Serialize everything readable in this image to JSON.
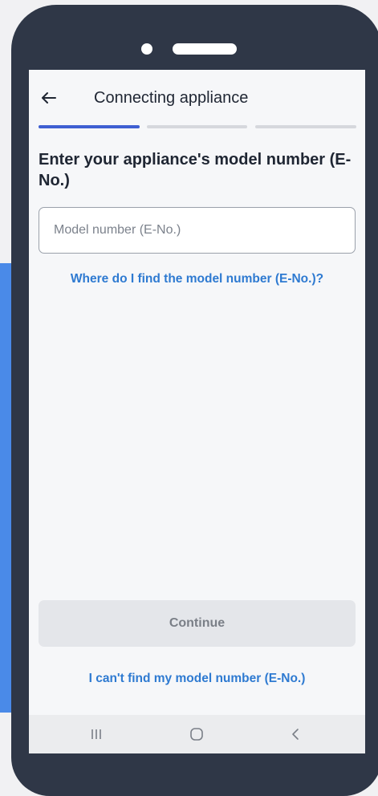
{
  "header": {
    "title": "Connecting appliance",
    "back_icon": "arrow-left-icon"
  },
  "progress": {
    "steps_total": 3,
    "current_step": 1,
    "current_step_fill": 1.0,
    "accent_color": "#3f5fd2"
  },
  "content": {
    "heading": "Enter your appliance's model number (E-No.)",
    "model_input": {
      "placeholder": "Model number (E-No.)",
      "value": ""
    },
    "help_link": "Where do I find the model number (E-No.)?"
  },
  "footer": {
    "continue_label": "Continue",
    "cant_find_link": "I can't find my model number (E-No.)"
  },
  "system_nav": {
    "recents_icon": "recents-icon",
    "home_icon": "home-icon",
    "back_icon": "back-chevron-icon"
  },
  "colors": {
    "link": "#2e7ad1",
    "device_frame": "#2f3747",
    "side_accent": "#4a8ae8",
    "disabled_button": "#e4e6ea"
  }
}
